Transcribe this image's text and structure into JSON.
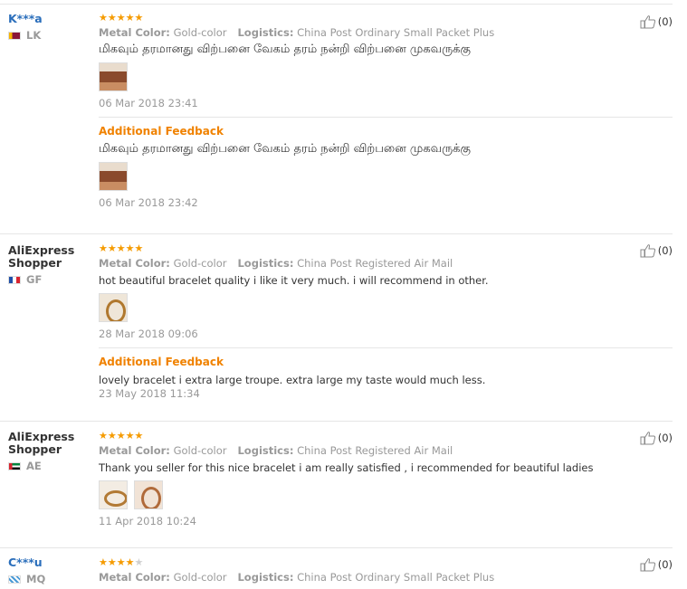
{
  "reviews": [
    {
      "name": "K***a",
      "country": "LK",
      "stars": "★★★★★",
      "stars_off": "",
      "metal_label": "Metal Color:",
      "metal_value": "Gold-color",
      "logistics_label": "Logistics:",
      "logistics_value": "China Post Ordinary Small Packet Plus",
      "text": "மிகவும் தரமானது விற்பனை வேகம் தரம் நன்றி விற்பனை முகவருக்கு",
      "date": "06 Mar 2018 23:41",
      "feedback_title": "Additional Feedback",
      "feedback_text": "மிகவும் தரமானது விற்பனை வேகம் தரம் நன்றி விற்பனை முகவருக்கு",
      "feedback_date": "06 Mar 2018 23:42",
      "helpful": "(0)"
    },
    {
      "name": "AliExpress Shopper",
      "country": "GF",
      "stars": "★★★★★",
      "stars_off": "",
      "metal_label": "Metal Color:",
      "metal_value": "Gold-color",
      "logistics_label": "Logistics:",
      "logistics_value": "China Post Registered Air Mail",
      "text": "hot beautiful bracelet quality i like it very much. i will recommend in other.",
      "date": "28 Mar 2018 09:06",
      "feedback_title": "Additional Feedback",
      "feedback_text": "lovely bracelet i extra large troupe. extra large my taste would much less.",
      "feedback_date": "23 May 2018 11:34",
      "helpful": "(0)"
    },
    {
      "name": "AliExpress Shopper",
      "country": "AE",
      "stars": "★★★★★",
      "stars_off": "",
      "metal_label": "Metal Color:",
      "metal_value": "Gold-color",
      "logistics_label": "Logistics:",
      "logistics_value": "China Post Registered Air Mail",
      "text": "Thank you seller for this nice bracelet i am really satisfied , i recommended for beautiful ladies",
      "date": "11 Apr 2018 10:24",
      "helpful": "(0)"
    },
    {
      "name": "C***u",
      "country": "MQ",
      "stars": "★★★★",
      "stars_off": "★",
      "metal_label": "Metal Color:",
      "metal_value": "Gold-color",
      "logistics_label": "Logistics:",
      "logistics_value": "China Post Ordinary Small Packet Plus",
      "helpful": "(0)"
    }
  ],
  "colors": {
    "star": "#f59b00",
    "feedback_title": "#f08200",
    "username_link": "#2a6ebb",
    "meta_text": "#999999"
  },
  "icons": {
    "helpful": "thumbs-up-icon",
    "flag": "country-flag-icon"
  }
}
